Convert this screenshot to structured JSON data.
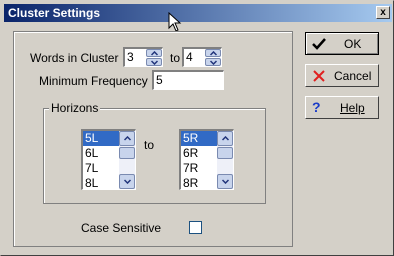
{
  "window": {
    "title": "Cluster Settings",
    "close_label": "x"
  },
  "words_in_cluster": {
    "label": "Words in Cluster",
    "from_value": "3",
    "to_label": "to",
    "to_value": "4"
  },
  "min_frequency": {
    "label": "Minimum Frequency",
    "value": "5"
  },
  "horizons": {
    "label": "Horizons",
    "to_label": "to",
    "left_items": [
      "5L",
      "6L",
      "7L",
      "8L"
    ],
    "right_items": [
      "5R",
      "6R",
      "7R",
      "8R"
    ]
  },
  "case_sensitive": {
    "label": "Case Sensitive",
    "checked": false
  },
  "buttons": {
    "ok": "OK",
    "cancel": "Cancel",
    "help": "Help"
  },
  "colors": {
    "titlebar_start": "#0a246a",
    "titlebar_end": "#a6caf0",
    "selection": "#316ac5"
  }
}
